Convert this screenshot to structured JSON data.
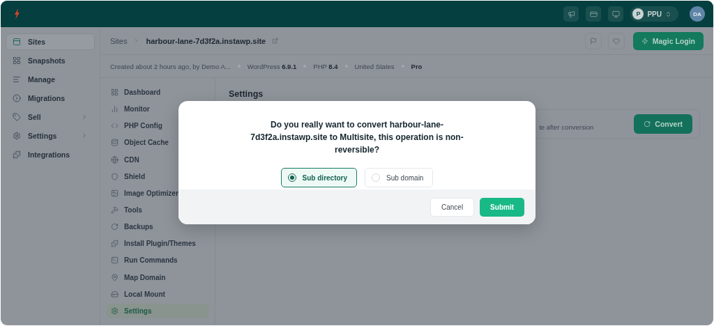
{
  "topbar": {
    "team": {
      "initial": "P",
      "name": "PPU"
    },
    "avatar": "DA"
  },
  "sidebar": {
    "items": [
      {
        "label": "Sites",
        "selected": true,
        "expandable": false
      },
      {
        "label": "Snapshots",
        "selected": false,
        "expandable": false
      },
      {
        "label": "Manage",
        "selected": false,
        "expandable": false
      },
      {
        "label": "Migrations",
        "selected": false,
        "expandable": false
      },
      {
        "label": "Sell",
        "selected": false,
        "expandable": true
      },
      {
        "label": "Settings",
        "selected": false,
        "expandable": true
      },
      {
        "label": "Integrations",
        "selected": false,
        "expandable": false
      }
    ]
  },
  "breadcrumb": {
    "parent": "Sites",
    "current": "harbour-lane-7d3f2a.instawp.site"
  },
  "header_actions": {
    "primary": "Magic Login"
  },
  "meta": [
    "Created about 2 hours ago, by Demo A...",
    "WordPress **6.9.1**",
    "PHP **8.4**",
    "United States",
    "**Pro**"
  ],
  "site_nav": [
    {
      "label": "Dashboard",
      "selected": false
    },
    {
      "label": "Monitor",
      "selected": false
    },
    {
      "label": "PHP Config",
      "selected": false
    },
    {
      "label": "Object Cache",
      "selected": false
    },
    {
      "label": "CDN",
      "selected": false
    },
    {
      "label": "Shield",
      "selected": false
    },
    {
      "label": "Image Optimizer",
      "selected": false
    },
    {
      "label": "Tools",
      "selected": false
    },
    {
      "label": "Backups",
      "selected": false
    },
    {
      "label": "Install Plugin/Themes",
      "selected": false
    },
    {
      "label": "Run Commands",
      "selected": false
    },
    {
      "label": "Map Domain",
      "selected": false
    },
    {
      "label": "Local Mount",
      "selected": false
    },
    {
      "label": "Settings",
      "selected": true
    }
  ],
  "content": {
    "title": "Settings",
    "card": {
      "description": "te after conversion",
      "button": "Convert"
    }
  },
  "dialog": {
    "message": "Do you really want to convert harbour-lane-7d3f2a.instawp.site to Multisite, this operation is non-reversible?",
    "options": [
      {
        "label": "Sub directory",
        "selected": true
      },
      {
        "label": "Sub domain",
        "selected": false
      }
    ],
    "buttons": [
      {
        "label": "Cancel",
        "kind": "secondary"
      },
      {
        "label": "Submit",
        "kind": "primary"
      }
    ]
  }
}
